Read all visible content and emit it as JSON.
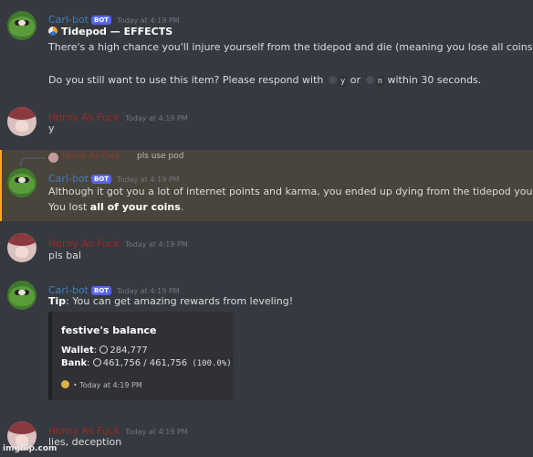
{
  "messages": [
    {
      "author": "Carl-bot",
      "badge": "BOT",
      "time": "Today at 4:19 PM",
      "title": "Tidepod — EFFECTS",
      "line1": "There's a high chance you'll injure yourself from the tidepod and die (meaning you lose all coins).",
      "line2_a": "Do you still want to use this item? Please respond with",
      "line2_y": "y",
      "line2_or": "or",
      "line2_n": "n",
      "line2_b": "within 30 seconds."
    },
    {
      "author": "Horny As Fuck",
      "time": "Today at 4:19 PM",
      "text": "y"
    },
    {
      "reply_name": "Horny As Fuck",
      "reply_text": "pls use pod",
      "author": "Carl-bot",
      "badge": "BOT",
      "time": "Today at 4:19 PM",
      "line1": "Although it got you a lot of internet points and karma, you ended up dying from the tidepod you ate.",
      "line2_a": "You lost",
      "line2_b": "all of your coins",
      "line2_c": "."
    },
    {
      "author": "Horny As Fuck",
      "time": "Today at 4:19 PM",
      "text": "pls bal"
    },
    {
      "author": "Carl-bot",
      "badge": "BOT",
      "time": "Today at 4:19 PM",
      "tip_label": "Tip",
      "tip_text": ": You can get amazing rewards from leveling!",
      "embed": {
        "title": "festive's balance",
        "wallet_label": "Wallet",
        "wallet_value": "284,777",
        "bank_label": "Bank",
        "bank_value": "461,756 / 461,756",
        "bank_pct": "(100.0%)",
        "footer": "• Today at 4:19 PM"
      }
    },
    {
      "author": "Horny As Fuck",
      "time": "Today at 4:19 PM",
      "text": "lies, deception"
    }
  ],
  "watermark": "imgflip.com",
  "colors": {
    "bot_name": "#3d7fbf",
    "user_name": "#9e2a24",
    "highlight": "#49443c",
    "background": "#36393f"
  }
}
